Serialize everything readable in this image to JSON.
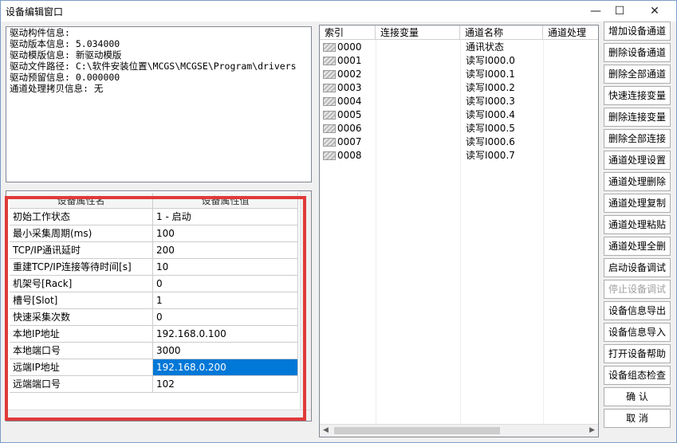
{
  "window": {
    "title": "设备编辑窗口"
  },
  "driver_info": {
    "lines": [
      "驱动构件信息:",
      "驱动版本信息: 5.034000",
      "驱动模版信息: 新驱动模版",
      "驱动文件路径: C:\\软件安装位置\\MCGS\\MCGSE\\Program\\drivers",
      "驱动预留信息: 0.000000",
      "通道处理拷贝信息: 无"
    ]
  },
  "properties": {
    "headers": [
      "设备属性名",
      "设备属性值"
    ],
    "rows": [
      {
        "name": "初始工作状态",
        "value": "1 - 启动"
      },
      {
        "name": "最小采集周期(ms)",
        "value": "100"
      },
      {
        "name": "TCP/IP通讯延时",
        "value": "200"
      },
      {
        "name": "重建TCP/IP连接等待时间[s]",
        "value": "10"
      },
      {
        "name": "机架号[Rack]",
        "value": "0"
      },
      {
        "name": "槽号[Slot]",
        "value": "1"
      },
      {
        "name": "快速采集次数",
        "value": "0"
      },
      {
        "name": "本地IP地址",
        "value": "192.168.0.100"
      },
      {
        "name": "本地端口号",
        "value": "3000"
      },
      {
        "name": "远端IP地址",
        "value": "192.168.0.200"
      },
      {
        "name": "远端端口号",
        "value": "102"
      }
    ]
  },
  "channels": {
    "headers": [
      "索引",
      "连接变量",
      "通道名称",
      "通道处理"
    ],
    "rows": [
      {
        "index": "0000",
        "variable": "",
        "name": "通讯状态",
        "process": ""
      },
      {
        "index": "0001",
        "variable": "",
        "name": "读写I000.0",
        "process": ""
      },
      {
        "index": "0002",
        "variable": "",
        "name": "读写I000.1",
        "process": ""
      },
      {
        "index": "0003",
        "variable": "",
        "name": "读写I000.2",
        "process": ""
      },
      {
        "index": "0004",
        "variable": "",
        "name": "读写I000.3",
        "process": ""
      },
      {
        "index": "0005",
        "variable": "",
        "name": "读写I000.4",
        "process": ""
      },
      {
        "index": "0006",
        "variable": "",
        "name": "读写I000.5",
        "process": ""
      },
      {
        "index": "0007",
        "variable": "",
        "name": "读写I000.6",
        "process": ""
      },
      {
        "index": "0008",
        "variable": "",
        "name": "读写I000.7",
        "process": ""
      }
    ]
  },
  "buttons": [
    {
      "id": "add-device-channel",
      "label": "增加设备通道",
      "enabled": true
    },
    {
      "id": "delete-device-channel",
      "label": "删除设备通道",
      "enabled": true
    },
    {
      "id": "delete-all-channels",
      "label": "删除全部通道",
      "enabled": true
    },
    {
      "id": "quick-connect-variable",
      "label": "快速连接变量",
      "enabled": true
    },
    {
      "id": "delete-connect-variable",
      "label": "删除连接变量",
      "enabled": true
    },
    {
      "id": "delete-all-connections",
      "label": "删除全部连接",
      "enabled": true
    },
    {
      "id": "channel-process-settings",
      "label": "通道处理设置",
      "enabled": true
    },
    {
      "id": "channel-process-delete",
      "label": "通道处理删除",
      "enabled": true
    },
    {
      "id": "channel-process-copy",
      "label": "通道处理复制",
      "enabled": true
    },
    {
      "id": "channel-process-paste",
      "label": "通道处理粘贴",
      "enabled": true
    },
    {
      "id": "channel-process-delete-all",
      "label": "通道处理全删",
      "enabled": true
    },
    {
      "id": "start-device-debug",
      "label": "启动设备调试",
      "enabled": true
    },
    {
      "id": "stop-device-debug",
      "label": "停止设备调试",
      "enabled": false
    },
    {
      "id": "device-info-export",
      "label": "设备信息导出",
      "enabled": true
    },
    {
      "id": "device-info-import",
      "label": "设备信息导入",
      "enabled": true
    },
    {
      "id": "open-device-help",
      "label": "打开设备帮助",
      "enabled": true
    },
    {
      "id": "device-config-check",
      "label": "设备组态检查",
      "enabled": true
    },
    {
      "id": "confirm",
      "label": "确          认",
      "enabled": true
    },
    {
      "id": "cancel",
      "label": "取          消",
      "enabled": true
    }
  ],
  "colors": {
    "selection": "#0078d7",
    "highlight_box": "#e03a3a",
    "border": "#828790"
  }
}
